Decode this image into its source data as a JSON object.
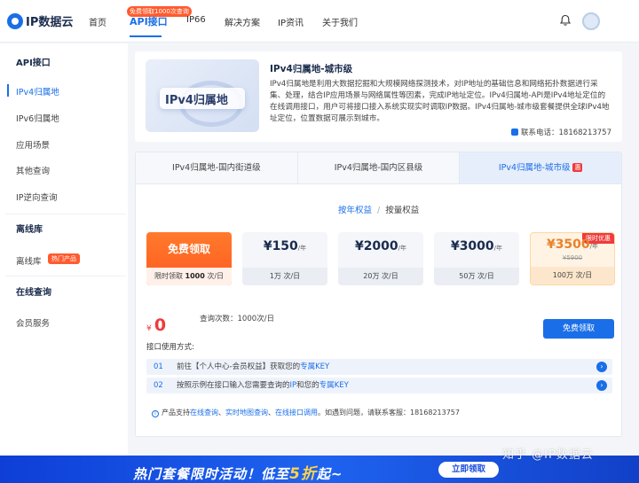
{
  "nav": {
    "logo": "IP数据云",
    "items": [
      "首页",
      "API接口",
      "IP66",
      "解决方案",
      "IP资讯",
      "关于我们"
    ],
    "badge": "免费领取1000次查询"
  },
  "sidebar": {
    "section1": "API接口",
    "items1": [
      "IPv4归属地",
      "IPv6归属地",
      "应用场景",
      "其他查询",
      "IP逆向查询"
    ],
    "section2": "离线库",
    "offline_item": "离线库",
    "offline_badge": "热门产品",
    "section3": "在线查询",
    "member_item": "会员服务"
  },
  "product": {
    "image_text": "IPv4归属地",
    "title": "IPv4归属地-城市级",
    "description": "IPv4归属地是利用大数据挖掘和大规模网络探测技术，对IP地址的基础信息和网络拓扑数据进行采集、处理，结合IP应用场景与网络属性等因素，完成IP地址定位。IPv4归属地-API是IPv4地址定位的在线调用接口，用户可将接口接入系统实现实时调取IP数据。IPv4归属地-城市级套餐提供全球IPv4地址定位，位置数据可展示到城市。",
    "phone_label": "联系电话：",
    "phone": "18168213757"
  },
  "tabs": [
    {
      "label": "IPv4归属地-国内街道级",
      "active": false
    },
    {
      "label": "IPv4归属地-国内区县级",
      "active": false
    },
    {
      "label": "IPv4归属地-城市级",
      "active": true,
      "tag": "惠"
    }
  ],
  "subtabs": {
    "active": "按年权益",
    "other": "按量权益",
    "sep": "/"
  },
  "plans": [
    {
      "price": "免费领取",
      "unit": "",
      "quota_label": "限时领取 ",
      "quota_value": "1000",
      "quota_unit": " 次/日"
    },
    {
      "price": "¥150",
      "unit": "/年",
      "quota": "1万 次/日"
    },
    {
      "price": "¥2000",
      "unit": "/年",
      "quota": "20万 次/日"
    },
    {
      "price": "¥3000",
      "unit": "/年",
      "quota": "50万 次/日"
    },
    {
      "price": "¥3500",
      "unit": "/年",
      "original": "¥5900",
      "quota": "100万 次/日",
      "tag": "限时优惠"
    }
  ],
  "total": {
    "currency": "¥",
    "amount": "0"
  },
  "usage": {
    "label": "查询次数：",
    "value": "1000次/日"
  },
  "free_button": "免费领取",
  "method_label": "接口使用方式:",
  "steps": [
    {
      "num": "01",
      "pre": "前往【个人中心-会员权益】获取您的",
      "link": "专属KEY",
      "post": ""
    },
    {
      "num": "02",
      "pre": "按照示例在接口输入您需要查询的",
      "link": "IP",
      "mid": "和您的",
      "link2": "专属KEY",
      "post": ""
    }
  ],
  "note": {
    "pre": "产品支持",
    "links": [
      "在线查询",
      "实时地图查询",
      "在线接口调用"
    ],
    "post": "。如遇到问题，请联系客服：",
    "phone": "18168213757"
  },
  "banner": {
    "pre": "热门套餐限时活动！低至",
    "emph": "5折",
    "post": "起~",
    "button": "立即领取"
  },
  "watermark": "知乎 @IP数据云",
  "colors": {
    "accent": "#1a6fe8",
    "orange": "#ff5a1f",
    "red": "#ef3b3b"
  }
}
